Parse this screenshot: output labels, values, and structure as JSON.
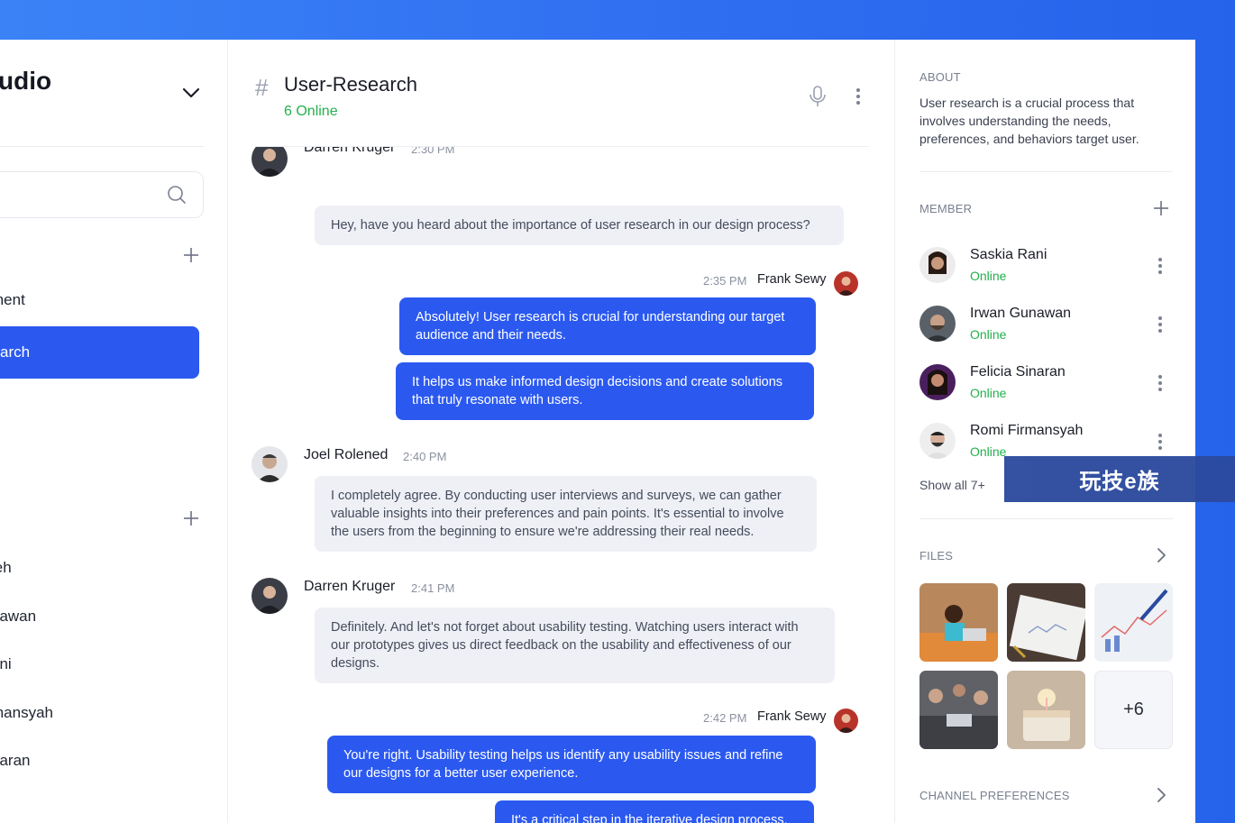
{
  "workspace": {
    "title": "udio"
  },
  "search": {
    "placeholder": ""
  },
  "channels": [
    {
      "label": "ment"
    },
    {
      "label": "arch"
    }
  ],
  "direct_messages": [
    {
      "label": "leh"
    },
    {
      "label": "nawan"
    },
    {
      "label": "ani"
    },
    {
      "label": "mansyah"
    },
    {
      "label": "naran"
    }
  ],
  "channel": {
    "name": "User-Research",
    "online": "6 Online"
  },
  "messages": {
    "m1": {
      "sender": "Darren Kruger",
      "time": "2:30 PM",
      "text": "Hey, have you heard about the importance of user research in our design process?"
    },
    "m2": {
      "sender": "Frank Sewy",
      "time": "2:35 PM",
      "lines": [
        "Absolutely! User research is crucial for understanding our target audience and their needs.",
        "It helps us make informed design decisions and create solutions that truly resonate with users."
      ]
    },
    "m3": {
      "sender": "Joel Rolened",
      "time": "2:40 PM",
      "text": "I completely agree. By conducting user interviews and surveys, we can gather valuable insights into their preferences and pain points. It's essential to involve the users from the beginning to ensure we're addressing their real needs."
    },
    "m4": {
      "sender": "Darren Kruger",
      "time": "2:41 PM",
      "text": "Definitely. And let's not forget about usability testing. Watching users interact with our prototypes gives us direct feedback on the usability and effectiveness of our designs."
    },
    "m5": {
      "sender": "Frank Sewy",
      "time": "2:42 PM",
      "lines": [
        "You're right. Usability testing helps us identify any usability issues and refine our designs for a better user experience.",
        "It's a critical step in the iterative design process."
      ]
    }
  },
  "about": {
    "label": "ABOUT",
    "text": "User research is a crucial process that involves understanding the needs, preferences, and behaviors target user."
  },
  "members": {
    "label": "MEMBER",
    "items": [
      {
        "name": "Saskia Rani",
        "status": "Online"
      },
      {
        "name": "Irwan Gunawan",
        "status": "Online"
      },
      {
        "name": "Felicia Sinaran",
        "status": "Online"
      },
      {
        "name": "Romi Firmansyah",
        "status": "Online"
      }
    ],
    "show_all": "Show all 7+"
  },
  "files": {
    "label": "FILES",
    "more": "+6"
  },
  "channel_preferences": {
    "label": "CHANNEL PREFERENCES"
  },
  "watermark": {
    "text": "玩技e族"
  },
  "colors": {
    "accent": "#2b59f0",
    "online": "#22b14c",
    "bubble_in": "#eef0f6",
    "background": "#3b82f6"
  },
  "icons": [
    "chevron-down-icon",
    "search-icon",
    "plus-icon",
    "hash-icon",
    "microphone-icon",
    "more-vertical-icon",
    "chevron-right-icon"
  ]
}
